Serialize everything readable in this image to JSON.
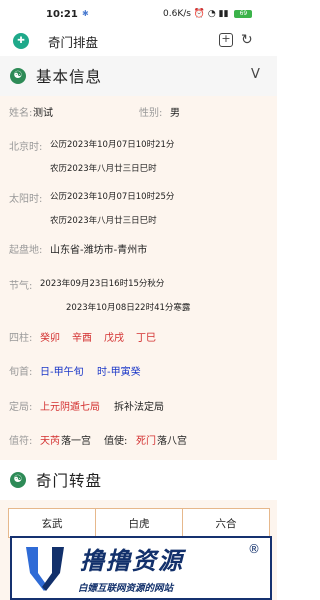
{
  "status": {
    "time": "10:21",
    "bt": "✱",
    "speed": "0.6K/s",
    "battery": "69"
  },
  "browser": {
    "title": "奇门排盘",
    "shield": "✚",
    "addtab": "+",
    "reload": "↻"
  },
  "basic": {
    "title": "基本信息",
    "toggle": "V",
    "name_label": "姓名:",
    "name_value": "测试",
    "gender_label": "性别:",
    "gender_value": "男",
    "beijing_label": "北京时:",
    "beijing_solar": "公历2023年10月07日10时21分",
    "beijing_lunar": "农历2023年八月廿三日巳时",
    "solar_label": "太阳时:",
    "solar_solar": "公历2023年10月07日10时25分",
    "solar_lunar": "农历2023年八月廿三日巳时",
    "place_label": "起盘地:",
    "place_value": "山东省-潍坊市-青州市",
    "jieqi_label": "节气:",
    "jieqi_1": "2023年09月23日16时15分秋分",
    "jieqi_2": "2023年10月08日22时41分寒露",
    "sizhu_label": "四柱:",
    "sizhu": [
      "癸卯",
      "辛酉",
      "戊戌",
      "丁巳"
    ],
    "xunshou_label": "旬首:",
    "xunshou_day": "日-甲午旬",
    "xunshou_hour": "时-甲寅癸",
    "ju_label": "定局:",
    "ju_value": "上元阴遁七局",
    "ju_method": "拆补法定局",
    "zhifu_label": "值符:",
    "zhifu_star": "天芮",
    "zhifu_palace": "落一宫",
    "zhishi_label": "值使:",
    "zhishi_door": "死门",
    "zhishi_palace": "落八宫"
  },
  "zhuanpan": {
    "title": "奇门转盘",
    "cells": [
      "玄武",
      "白虎",
      "六合"
    ]
  },
  "watermark": {
    "big": "撸撸资源",
    "sub": "白嫖互联网资源的网站",
    "reg": "®"
  }
}
